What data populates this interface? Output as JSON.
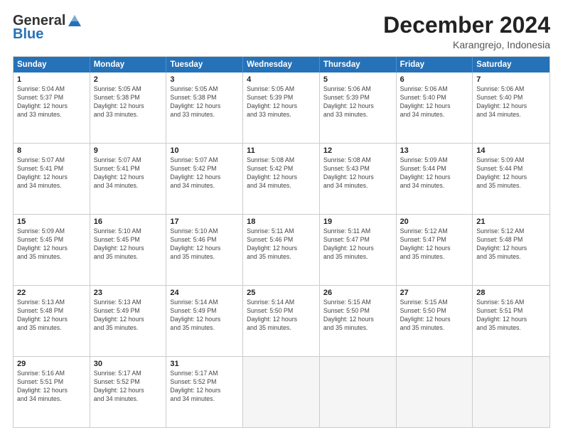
{
  "logo": {
    "general": "General",
    "blue": "Blue"
  },
  "title": "December 2024",
  "subtitle": "Karangrejo, Indonesia",
  "header_days": [
    "Sunday",
    "Monday",
    "Tuesday",
    "Wednesday",
    "Thursday",
    "Friday",
    "Saturday"
  ],
  "rows": [
    [
      {
        "day": "1",
        "info": "Sunrise: 5:04 AM\nSunset: 5:37 PM\nDaylight: 12 hours\nand 33 minutes."
      },
      {
        "day": "2",
        "info": "Sunrise: 5:05 AM\nSunset: 5:38 PM\nDaylight: 12 hours\nand 33 minutes."
      },
      {
        "day": "3",
        "info": "Sunrise: 5:05 AM\nSunset: 5:38 PM\nDaylight: 12 hours\nand 33 minutes."
      },
      {
        "day": "4",
        "info": "Sunrise: 5:05 AM\nSunset: 5:39 PM\nDaylight: 12 hours\nand 33 minutes."
      },
      {
        "day": "5",
        "info": "Sunrise: 5:06 AM\nSunset: 5:39 PM\nDaylight: 12 hours\nand 33 minutes."
      },
      {
        "day": "6",
        "info": "Sunrise: 5:06 AM\nSunset: 5:40 PM\nDaylight: 12 hours\nand 34 minutes."
      },
      {
        "day": "7",
        "info": "Sunrise: 5:06 AM\nSunset: 5:40 PM\nDaylight: 12 hours\nand 34 minutes."
      }
    ],
    [
      {
        "day": "8",
        "info": "Sunrise: 5:07 AM\nSunset: 5:41 PM\nDaylight: 12 hours\nand 34 minutes."
      },
      {
        "day": "9",
        "info": "Sunrise: 5:07 AM\nSunset: 5:41 PM\nDaylight: 12 hours\nand 34 minutes."
      },
      {
        "day": "10",
        "info": "Sunrise: 5:07 AM\nSunset: 5:42 PM\nDaylight: 12 hours\nand 34 minutes."
      },
      {
        "day": "11",
        "info": "Sunrise: 5:08 AM\nSunset: 5:42 PM\nDaylight: 12 hours\nand 34 minutes."
      },
      {
        "day": "12",
        "info": "Sunrise: 5:08 AM\nSunset: 5:43 PM\nDaylight: 12 hours\nand 34 minutes."
      },
      {
        "day": "13",
        "info": "Sunrise: 5:09 AM\nSunset: 5:44 PM\nDaylight: 12 hours\nand 34 minutes."
      },
      {
        "day": "14",
        "info": "Sunrise: 5:09 AM\nSunset: 5:44 PM\nDaylight: 12 hours\nand 35 minutes."
      }
    ],
    [
      {
        "day": "15",
        "info": "Sunrise: 5:09 AM\nSunset: 5:45 PM\nDaylight: 12 hours\nand 35 minutes."
      },
      {
        "day": "16",
        "info": "Sunrise: 5:10 AM\nSunset: 5:45 PM\nDaylight: 12 hours\nand 35 minutes."
      },
      {
        "day": "17",
        "info": "Sunrise: 5:10 AM\nSunset: 5:46 PM\nDaylight: 12 hours\nand 35 minutes."
      },
      {
        "day": "18",
        "info": "Sunrise: 5:11 AM\nSunset: 5:46 PM\nDaylight: 12 hours\nand 35 minutes."
      },
      {
        "day": "19",
        "info": "Sunrise: 5:11 AM\nSunset: 5:47 PM\nDaylight: 12 hours\nand 35 minutes."
      },
      {
        "day": "20",
        "info": "Sunrise: 5:12 AM\nSunset: 5:47 PM\nDaylight: 12 hours\nand 35 minutes."
      },
      {
        "day": "21",
        "info": "Sunrise: 5:12 AM\nSunset: 5:48 PM\nDaylight: 12 hours\nand 35 minutes."
      }
    ],
    [
      {
        "day": "22",
        "info": "Sunrise: 5:13 AM\nSunset: 5:48 PM\nDaylight: 12 hours\nand 35 minutes."
      },
      {
        "day": "23",
        "info": "Sunrise: 5:13 AM\nSunset: 5:49 PM\nDaylight: 12 hours\nand 35 minutes."
      },
      {
        "day": "24",
        "info": "Sunrise: 5:14 AM\nSunset: 5:49 PM\nDaylight: 12 hours\nand 35 minutes."
      },
      {
        "day": "25",
        "info": "Sunrise: 5:14 AM\nSunset: 5:50 PM\nDaylight: 12 hours\nand 35 minutes."
      },
      {
        "day": "26",
        "info": "Sunrise: 5:15 AM\nSunset: 5:50 PM\nDaylight: 12 hours\nand 35 minutes."
      },
      {
        "day": "27",
        "info": "Sunrise: 5:15 AM\nSunset: 5:50 PM\nDaylight: 12 hours\nand 35 minutes."
      },
      {
        "day": "28",
        "info": "Sunrise: 5:16 AM\nSunset: 5:51 PM\nDaylight: 12 hours\nand 35 minutes."
      }
    ],
    [
      {
        "day": "29",
        "info": "Sunrise: 5:16 AM\nSunset: 5:51 PM\nDaylight: 12 hours\nand 34 minutes."
      },
      {
        "day": "30",
        "info": "Sunrise: 5:17 AM\nSunset: 5:52 PM\nDaylight: 12 hours\nand 34 minutes."
      },
      {
        "day": "31",
        "info": "Sunrise: 5:17 AM\nSunset: 5:52 PM\nDaylight: 12 hours\nand 34 minutes."
      },
      {
        "day": "",
        "info": ""
      },
      {
        "day": "",
        "info": ""
      },
      {
        "day": "",
        "info": ""
      },
      {
        "day": "",
        "info": ""
      }
    ]
  ]
}
